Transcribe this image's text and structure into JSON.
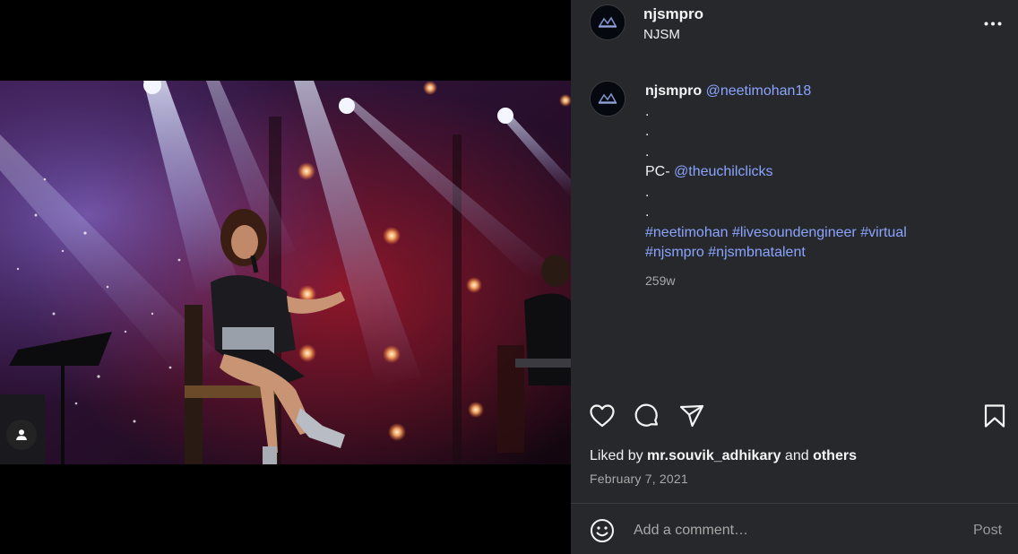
{
  "post": {
    "account": {
      "username": "njsmpro",
      "subtitle": "NJSM"
    },
    "caption": {
      "username": "njsmpro",
      "mention_1": "@neetimohan18",
      "dot": ".",
      "pc_prefix": "PC- ",
      "mention_2": "@theuchilclicks",
      "hashtags": [
        "#neetimohan",
        "#livesoundengineer",
        "#virtual",
        "#njsmpro",
        "#njsmbnatalent"
      ],
      "time_ago": "259w"
    },
    "actions": {
      "like_icon": "heart-icon",
      "comment_icon": "comment-icon",
      "share_icon": "paper-plane-icon",
      "save_icon": "bookmark-icon"
    },
    "likes": {
      "prefix": "Liked by ",
      "user": "mr.souvik_adhikary",
      "connector": " and ",
      "others": "others"
    },
    "date": "February 7, 2021",
    "comment_box": {
      "emoji_icon": "smiley-icon",
      "placeholder": "Add a comment…",
      "post_label": "Post"
    },
    "media": {
      "tag_icon": "person-icon"
    }
  },
  "colors": {
    "panel_bg": "#26282b",
    "link": "#8aa4ff",
    "muted": "#a8a8a8",
    "text": "#f5f5f5"
  }
}
